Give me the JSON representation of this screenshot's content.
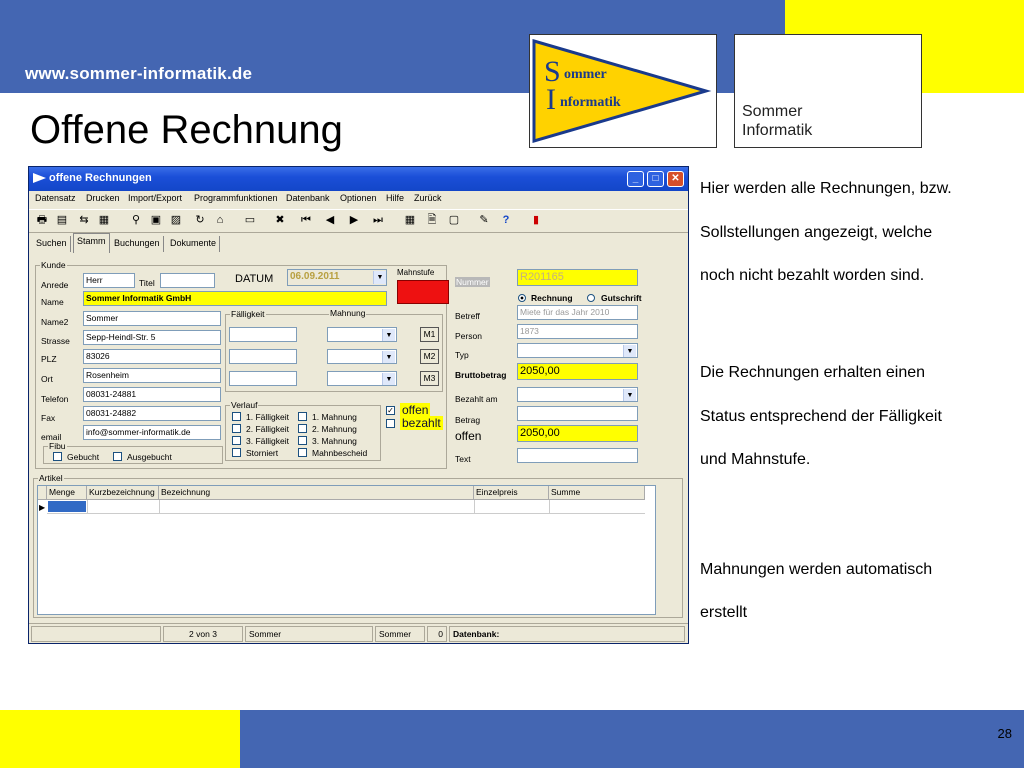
{
  "slide": {
    "site_url": "www.sommer-informatik.de",
    "title": "Offene Rechnung",
    "logo_small": {
      "line1": "ommer",
      "line2": "nformatik",
      "s": "S",
      "i": "I"
    },
    "logo_large": {
      "line1": "Sommer",
      "line2": "Informatik"
    },
    "page_number": "28",
    "description": {
      "p1": [
        "Hier werden alle Rechnungen, bzw.",
        "Sollstellungen angezeigt, welche",
        "noch nicht bezahlt worden sind."
      ],
      "p2": [
        "Die Rechnungen erhalten einen",
        "Status entsprechend der Fälligkeit",
        "und Mahnstufe."
      ],
      "p3": [
        "Mahnungen werden automatisch",
        "erstellt"
      ]
    },
    "colors": {
      "blue": "#4466b2",
      "yellow": "#ffff00"
    }
  },
  "window": {
    "title": "offene Rechnungen",
    "menu": [
      "Datensatz",
      "Drucken",
      "Import/Export",
      "Programmfunktionen",
      "Datenbank",
      "Optionen",
      "Hilfe",
      "Zurück"
    ],
    "tabs": [
      "Suchen",
      "Stamm",
      "Buchungen",
      "Dokumente"
    ],
    "kunde": {
      "group_label": "Kunde",
      "anrede_label": "Anrede",
      "anrede": "Herr",
      "titel_label": "Titel",
      "titel": "",
      "datum_label": "DATUM",
      "datum": "06.09.2011",
      "mahnstufe_label": "Mahnstufe",
      "name_label": "Name",
      "name": "Sommer Informatik GmbH",
      "name2_label": "Name2",
      "name2": "Sommer",
      "strasse_label": "Strasse",
      "strasse": "Sepp-Heindl-Str. 5",
      "plz_label": "PLZ",
      "plz": "83026",
      "ort_label": "Ort",
      "ort": "Rosenheim",
      "telefon_label": "Telefon",
      "telefon": "08031-24881",
      "fax_label": "Fax",
      "fax": "08031-24882",
      "email_label": "email",
      "email": "info@sommer-informatik.de"
    },
    "faelligkeit_label": "Fälligkeit",
    "mahnung_label": "Mahnung",
    "mahn_buttons": [
      "M1",
      "M2",
      "M3"
    ],
    "fibu": {
      "label": "Fibu",
      "gebucht": "Gebucht",
      "ausgebucht": "Ausgebucht"
    },
    "verlauf": {
      "label": "Verlauf",
      "items": [
        "1. Fälligkeit",
        "2. Fälligkeit",
        "3. Fälligkeit",
        "Storniert"
      ],
      "items2": [
        "1. Mahnung",
        "2. Mahnung",
        "3. Mahnung",
        "Mahnbescheid"
      ]
    },
    "status": {
      "offen": "offen",
      "bezahlt": "bezahlt"
    },
    "right": {
      "nummer_label": "Nummer",
      "nummer": "R201165",
      "rechnung": "Rechnung",
      "gutschrift": "Gutschrift",
      "betreff_label": "Betreff",
      "betreff": "Miete für das Jahr 2010",
      "person_label": "Person",
      "person": "1873",
      "typ_label": "Typ",
      "brutto_label": "Bruttobetrag",
      "brutto": "2050,00",
      "bezahlt_am_label": "Bezahlt am",
      "betrag_label": "Betrag",
      "offen_text": "offen",
      "offen_betrag": "2050,00",
      "text_label": "Text"
    },
    "artikel": {
      "label": "Artikel",
      "columns": [
        "Menge",
        "Kurzbezeichnung",
        "Bezeichnung",
        "Einzelpreis",
        "Summe"
      ]
    },
    "statusbar": {
      "record": "2 von 3",
      "user": "Sommer",
      "user2": "Sommer",
      "count": "0",
      "db": "Datenbank:"
    }
  }
}
